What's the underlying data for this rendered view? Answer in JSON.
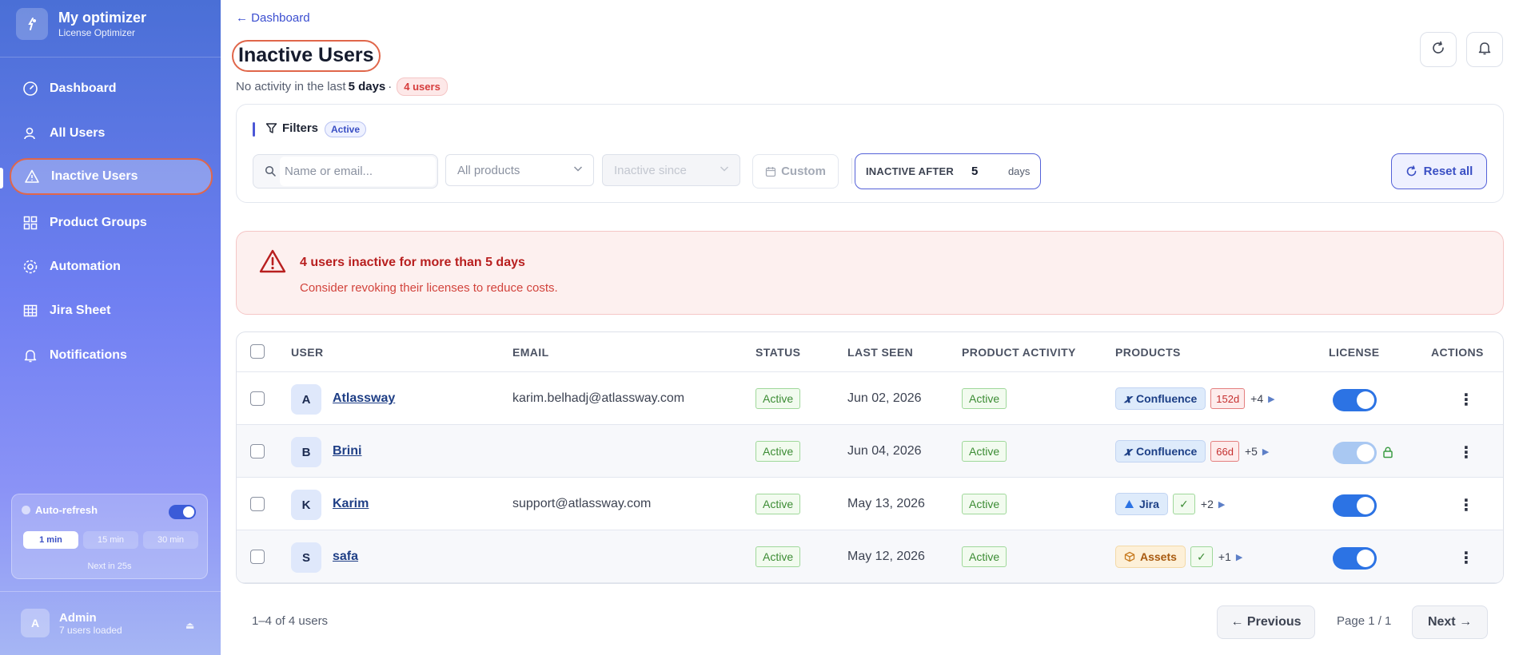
{
  "brand": {
    "title": "My optimizer",
    "subtitle": "License Optimizer"
  },
  "nav": [
    {
      "label": "Dashboard",
      "icon": "gauge-icon"
    },
    {
      "label": "All Users",
      "icon": "users-icon"
    },
    {
      "label": "Inactive Users",
      "icon": "warning-icon",
      "active": true
    },
    {
      "label": "Product Groups",
      "icon": "grid-icon"
    },
    {
      "label": "Automation",
      "icon": "gear-icon"
    },
    {
      "label": "Jira Sheet",
      "icon": "table-icon"
    },
    {
      "label": "Notifications",
      "icon": "bell-icon"
    }
  ],
  "autorefresh": {
    "label": "Auto-refresh",
    "options": [
      "1 min",
      "15 min",
      "30 min"
    ],
    "selected": "1 min",
    "next": "Next in 25s"
  },
  "admin": {
    "initial": "A",
    "name": "Admin",
    "sub": "7 users loaded"
  },
  "header": {
    "back": "← Dashboard",
    "title": "Inactive Users",
    "subtitle_prefix": "No activity in the last",
    "subtitle_days": "5 days",
    "subtitle_sep": "·",
    "user_count_badge": "4 users"
  },
  "filters": {
    "label": "Filters",
    "state": "Active",
    "search_placeholder": "Name or email...",
    "products_placeholder": "All products",
    "inactive_since_placeholder": "Inactive since",
    "custom_label": "Custom",
    "inactive_after_label": "INACTIVE AFTER",
    "inactive_after_value": "5",
    "inactive_after_unit": "days",
    "reset_label": "Reset all"
  },
  "alert": {
    "title": "4 users inactive for more than 5 days",
    "subtitle": "Consider revoking their licenses to reduce costs."
  },
  "table": {
    "columns": [
      "USER",
      "EMAIL",
      "STATUS",
      "LAST SEEN",
      "PRODUCT ACTIVITY",
      "PRODUCTS",
      "LICENSE",
      "ACTIONS"
    ],
    "rows": [
      {
        "initial": "A",
        "name": "Atlassway",
        "email": "karim.belhadj@atlassway.com",
        "status": "Active",
        "last_seen": "Jun 02, 2026",
        "activity": "Active",
        "product": "Confluence",
        "product_icon": "confluence-icon",
        "product_tag": "152d",
        "more": "+4",
        "license_on": true,
        "locked": false
      },
      {
        "initial": "B",
        "name": "Brini",
        "email": "",
        "status": "Active",
        "last_seen": "Jun 04, 2026",
        "activity": "Active",
        "product": "Confluence",
        "product_icon": "confluence-icon",
        "product_tag": "66d",
        "more": "+5",
        "license_on": true,
        "locked": true
      },
      {
        "initial": "K",
        "name": "Karim",
        "email": "support@atlassway.com",
        "status": "Active",
        "last_seen": "May 13, 2026",
        "activity": "Active",
        "product": "Jira",
        "product_icon": "jira-icon",
        "product_tag": "✓",
        "more": "+2",
        "license_on": true,
        "locked": false
      },
      {
        "initial": "S",
        "name": "safa",
        "email": "",
        "status": "Active",
        "last_seen": "May 12, 2026",
        "activity": "Active",
        "product": "Assets",
        "product_icon": "assets-icon",
        "product_tag": "✓",
        "more": "+1",
        "license_on": true,
        "locked": false
      }
    ]
  },
  "pagination": {
    "count": "1–4 of 4 users",
    "previous": "← Previous",
    "page_info": "Page 1 / 1",
    "next": "Next →"
  },
  "colors": {
    "accent": "#4b57d6",
    "danger": "#b81f1f",
    "success": "#3c8c34",
    "toggle": "#2c73e4"
  }
}
